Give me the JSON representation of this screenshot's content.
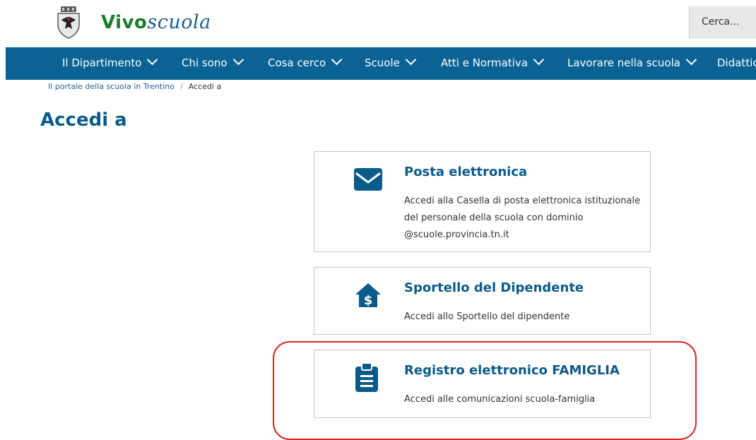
{
  "header": {
    "logo_vivo": "Vivo",
    "logo_scuola": "scuola",
    "search_placeholder": "Cerca..."
  },
  "nav": {
    "items": [
      {
        "label": "Il Dipartimento"
      },
      {
        "label": "Chi sono"
      },
      {
        "label": "Cosa cerco"
      },
      {
        "label": "Scuole"
      },
      {
        "label": "Atti e Normativa"
      },
      {
        "label": "Lavorare nella scuola"
      },
      {
        "label": "Didattica"
      }
    ]
  },
  "breadcrumb": {
    "home": "Il portale della scuola in Trentino",
    "separator": "/",
    "current": "Accedi a"
  },
  "page": {
    "title": "Accedi a"
  },
  "cards": [
    {
      "icon": "envelope-icon",
      "title": "Posta elettronica",
      "description": "Accedi alla Casella di posta elettronica istituzionale del personale della scuola con dominio @scuole.provincia.tn.it"
    },
    {
      "icon": "house-dollar-icon",
      "title": "Sportello del Dipendente",
      "description": "Accedi allo Sportello del dipendente"
    },
    {
      "icon": "clipboard-list-icon",
      "title": "Registro elettronico FAMIGLIA",
      "description": "Accedi alle comunicazioni scuola-famiglia"
    }
  ],
  "colors": {
    "nav_bg": "#0a6394",
    "title_blue": "#0a5a8a",
    "highlight_red": "#e02424"
  }
}
